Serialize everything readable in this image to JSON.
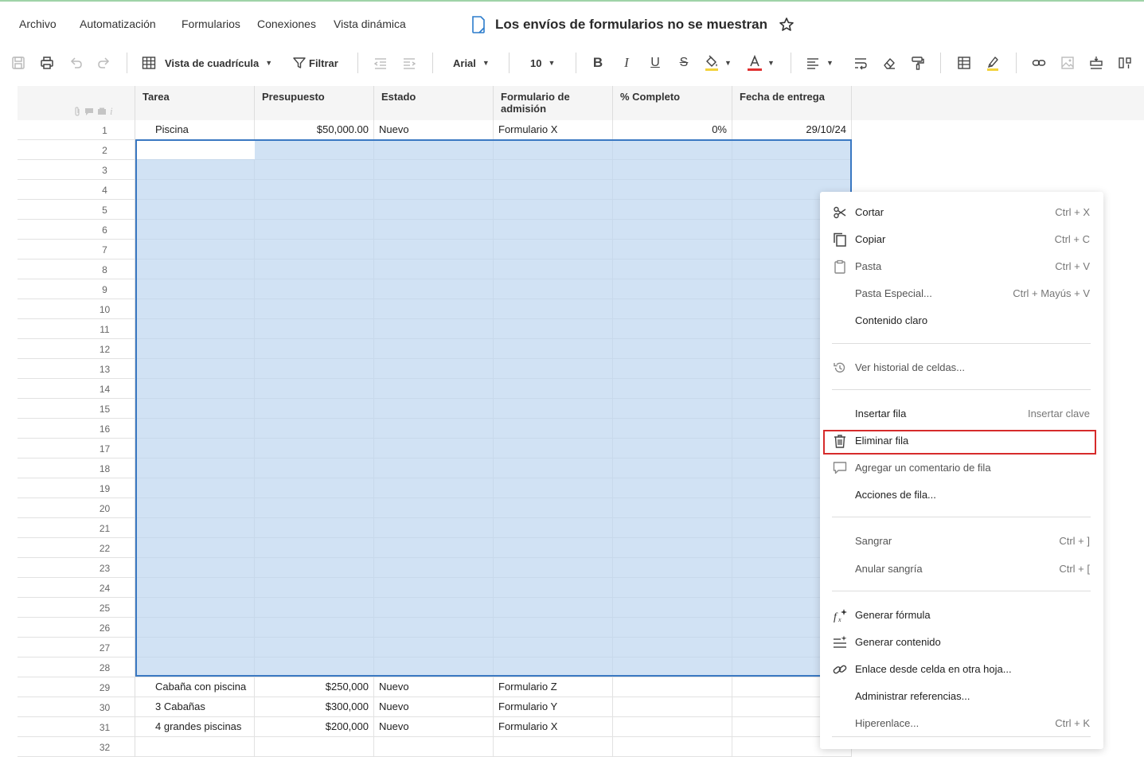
{
  "menu": {
    "items": [
      "Archivo",
      "Automatización",
      "Formularios",
      "Conexiones",
      "Vista dinámica"
    ]
  },
  "document": {
    "title": "Los envíos de formularios no se muestran"
  },
  "toolbar": {
    "view_label": "Vista de cuadrícula",
    "filter_label": "Filtrar",
    "font_name": "Arial",
    "font_size": "10",
    "fill_color": "#f2d23a",
    "text_color": "#e03131"
  },
  "sheet": {
    "columns": [
      "Tarea",
      "Presupuesto",
      "Estado",
      "Formulario de admisión",
      "% Completo",
      "Fecha de entrega"
    ],
    "rows": [
      {
        "num": "1",
        "cells": [
          "Piscina",
          "$50,000.00",
          "Nuevo",
          "Formulario X",
          "0%",
          "29/10/24"
        ]
      },
      {
        "num": "2",
        "cells": [
          "",
          "",
          "",
          "",
          "",
          ""
        ]
      },
      {
        "num": "3",
        "cells": [
          "",
          "",
          "",
          "",
          "",
          ""
        ]
      },
      {
        "num": "4",
        "cells": [
          "",
          "",
          "",
          "",
          "",
          ""
        ]
      },
      {
        "num": "5",
        "cells": [
          "",
          "",
          "",
          "",
          "",
          ""
        ]
      },
      {
        "num": "6",
        "cells": [
          "",
          "",
          "",
          "",
          "",
          ""
        ]
      },
      {
        "num": "7",
        "cells": [
          "",
          "",
          "",
          "",
          "",
          ""
        ]
      },
      {
        "num": "8",
        "cells": [
          "",
          "",
          "",
          "",
          "",
          ""
        ]
      },
      {
        "num": "9",
        "cells": [
          "",
          "",
          "",
          "",
          "",
          ""
        ]
      },
      {
        "num": "10",
        "cells": [
          "",
          "",
          "",
          "",
          "",
          ""
        ]
      },
      {
        "num": "11",
        "cells": [
          "",
          "",
          "",
          "",
          "",
          ""
        ]
      },
      {
        "num": "12",
        "cells": [
          "",
          "",
          "",
          "",
          "",
          ""
        ]
      },
      {
        "num": "13",
        "cells": [
          "",
          "",
          "",
          "",
          "",
          ""
        ]
      },
      {
        "num": "14",
        "cells": [
          "",
          "",
          "",
          "",
          "",
          ""
        ]
      },
      {
        "num": "15",
        "cells": [
          "",
          "",
          "",
          "",
          "",
          ""
        ]
      },
      {
        "num": "16",
        "cells": [
          "",
          "",
          "",
          "",
          "",
          ""
        ]
      },
      {
        "num": "17",
        "cells": [
          "",
          "",
          "",
          "",
          "",
          ""
        ]
      },
      {
        "num": "18",
        "cells": [
          "",
          "",
          "",
          "",
          "",
          ""
        ]
      },
      {
        "num": "19",
        "cells": [
          "",
          "",
          "",
          "",
          "",
          ""
        ]
      },
      {
        "num": "20",
        "cells": [
          "",
          "",
          "",
          "",
          "",
          ""
        ]
      },
      {
        "num": "21",
        "cells": [
          "",
          "",
          "",
          "",
          "",
          ""
        ]
      },
      {
        "num": "22",
        "cells": [
          "",
          "",
          "",
          "",
          "",
          ""
        ]
      },
      {
        "num": "23",
        "cells": [
          "",
          "",
          "",
          "",
          "",
          ""
        ]
      },
      {
        "num": "24",
        "cells": [
          "",
          "",
          "",
          "",
          "",
          ""
        ]
      },
      {
        "num": "25",
        "cells": [
          "",
          "",
          "",
          "",
          "",
          ""
        ]
      },
      {
        "num": "26",
        "cells": [
          "",
          "",
          "",
          "",
          "",
          ""
        ]
      },
      {
        "num": "27",
        "cells": [
          "",
          "",
          "",
          "",
          "",
          ""
        ]
      },
      {
        "num": "28",
        "cells": [
          "",
          "",
          "",
          "",
          "",
          ""
        ]
      },
      {
        "num": "29",
        "cells": [
          "Cabaña con piscina",
          "$250,000",
          "Nuevo",
          "Formulario Z",
          "",
          ""
        ]
      },
      {
        "num": "30",
        "cells": [
          "3 Cabañas",
          "$300,000",
          "Nuevo",
          "Formulario Y",
          "",
          ""
        ]
      },
      {
        "num": "31",
        "cells": [
          "4 grandes piscinas",
          "$200,000",
          "Nuevo",
          "Formulario X",
          "",
          ""
        ]
      },
      {
        "num": "32",
        "cells": [
          "",
          "",
          "",
          "",
          "",
          ""
        ]
      }
    ]
  },
  "context_menu": {
    "items": [
      {
        "label": "Cortar",
        "shortcut": "Ctrl + X",
        "icon": "scissors-icon"
      },
      {
        "label": "Copiar",
        "shortcut": "Ctrl + C",
        "icon": "copy-icon"
      },
      {
        "label": "Pasta",
        "shortcut": "Ctrl + V",
        "icon": "clipboard-icon"
      },
      {
        "label": "Pasta Especial...",
        "shortcut": "Ctrl + Mayús + V",
        "icon": ""
      },
      {
        "label": "Contenido claro",
        "shortcut": "",
        "icon": ""
      },
      {
        "label": "Ver historial de celdas...",
        "shortcut": "",
        "icon": "history-icon"
      },
      {
        "label": "Insertar fila",
        "shortcut": "Insertar clave",
        "icon": ""
      },
      {
        "label": "Eliminar fila",
        "shortcut": "",
        "icon": "trash-icon"
      },
      {
        "label": "Agregar un comentario de fila",
        "shortcut": "",
        "icon": "comment-icon"
      },
      {
        "label": "Acciones de fila...",
        "shortcut": "",
        "icon": ""
      },
      {
        "label": "Sangrar",
        "shortcut": "Ctrl + ]",
        "icon": ""
      },
      {
        "label": "Anular sangría",
        "shortcut": "Ctrl + [",
        "icon": ""
      },
      {
        "label": "Generar fórmula",
        "shortcut": "",
        "icon": "formula-ai-icon"
      },
      {
        "label": "Generar contenido",
        "shortcut": "",
        "icon": "content-ai-icon"
      },
      {
        "label": "Enlace desde celda en otra hoja...",
        "shortcut": "",
        "icon": "link-icon"
      },
      {
        "label": "Administrar referencias...",
        "shortcut": "",
        "icon": ""
      },
      {
        "label": "Hiperenlace...",
        "shortcut": "Ctrl + K",
        "icon": ""
      }
    ],
    "highlighted": "Eliminar fila",
    "highlight_color": "#d62b2b"
  }
}
